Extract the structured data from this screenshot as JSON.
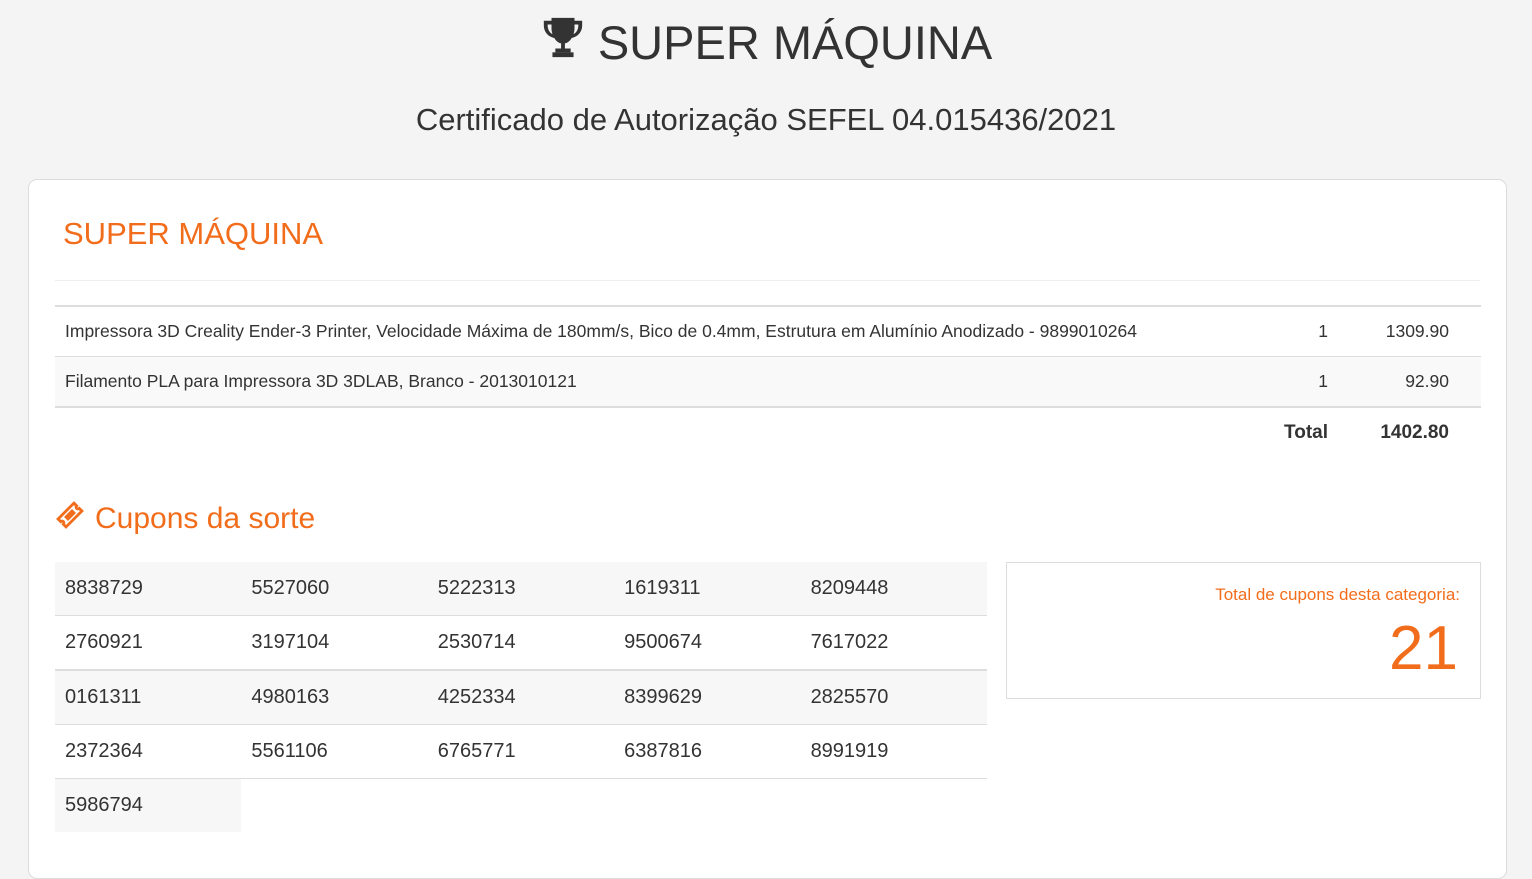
{
  "header": {
    "title": "SUPER MÁQUINA",
    "title_icon": "trophy-icon",
    "subtitle": "Certificado de Autorização SEFEL 04.015436/2021"
  },
  "card": {
    "title": "SUPER MÁQUINA",
    "items": [
      {
        "description": "Impressora 3D Creality Ender-3 Printer, Velocidade Máxima de 180mm/s, Bico de 0.4mm, Estrutura em Alumínio Anodizado - 9899010264",
        "qty": "1",
        "price": "1309.90"
      },
      {
        "description": "Filamento PLA para Impressora 3D 3DLAB, Branco - 2013010121",
        "qty": "1",
        "price": "92.90"
      }
    ],
    "total_label": "Total",
    "total_value": "1402.80"
  },
  "coupons": {
    "title": "Cupons da sorte",
    "title_icon": "ticket-icon",
    "rows": [
      [
        "8838729",
        "5527060",
        "5222313",
        "1619311",
        "8209448"
      ],
      [
        "2760921",
        "3197104",
        "2530714",
        "9500674",
        "7617022"
      ],
      [
        "0161311",
        "4980163",
        "4252334",
        "8399629",
        "2825570"
      ],
      [
        "2372364",
        "5561106",
        "6765771",
        "6387816",
        "8991919"
      ],
      [
        "5986794"
      ]
    ],
    "total_label": "Total de cupons desta categoria:",
    "total_count": "21"
  },
  "colors": {
    "accent": "#f26d1b",
    "background": "#f4f4f4",
    "text": "#333333"
  }
}
